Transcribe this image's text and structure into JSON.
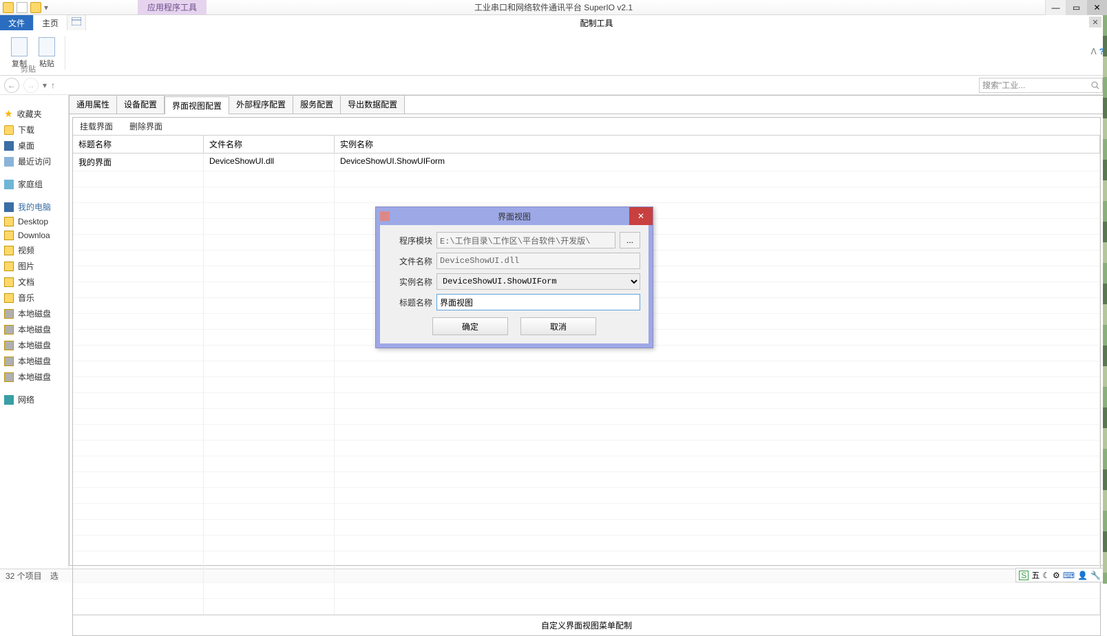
{
  "titlebar": {
    "app_tools": "应用程序工具",
    "window_title": "工业串口和网络软件通讯平台 SuperIO v2.1"
  },
  "inner_window": {
    "title": "配制工具"
  },
  "ribbon": {
    "file_tab": "文件",
    "home_tab": "主页",
    "copy": "复制",
    "paste": "粘贴",
    "group": "剪贴"
  },
  "nav": {
    "search_placeholder": "搜索\"工业..."
  },
  "explorer": {
    "favorites": "收藏夹",
    "downloads": "下载",
    "desktop": "桌面",
    "recent": "最近访问",
    "homegroup": "家庭组",
    "computer": "我的电脑",
    "items": [
      "Desktop",
      "Downloa",
      "视频",
      "图片",
      "文档",
      "音乐",
      "本地磁盘",
      "本地磁盘",
      "本地磁盘",
      "本地磁盘",
      "本地磁盘"
    ],
    "network": "网络"
  },
  "config": {
    "tabs": [
      "通用属性",
      "设备配置",
      "界面视图配置",
      "外部程序配置",
      "服务配置",
      "导出数据配置"
    ],
    "active_tab_index": 2,
    "subtabs": [
      "挂载界面",
      "删除界面"
    ],
    "columns": [
      "标题名称",
      "文件名称",
      "实例名称"
    ],
    "rows": [
      {
        "title": "我的界面",
        "file": "DeviceShowUI.dll",
        "instance": "DeviceShowUI.ShowUIForm"
      }
    ],
    "footer": "自定义界面视图菜单配制"
  },
  "modal": {
    "title": "界面视图",
    "labels": {
      "module": "程序模块",
      "file": "文件名称",
      "instance": "实例名称",
      "caption": "标题名称"
    },
    "values": {
      "module": "E:\\工作目录\\工作区\\平台软件\\开发版\\",
      "file": "DeviceShowUI.dll",
      "instance": "DeviceShowUI.ShowUIForm",
      "caption": "界面视图"
    },
    "browse": "...",
    "ok": "确定",
    "cancel": "取消"
  },
  "statusbar": {
    "count": "32 个项目",
    "selected": "选"
  },
  "ime": {
    "label": "五"
  }
}
